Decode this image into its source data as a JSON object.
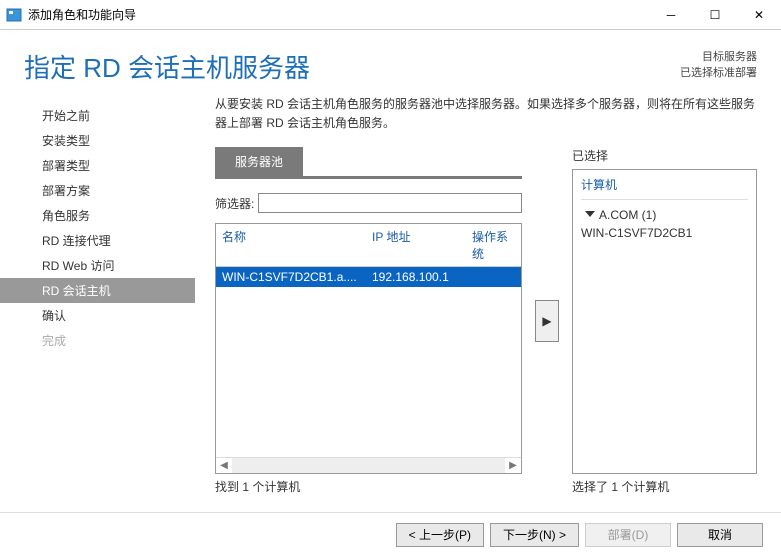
{
  "window": {
    "title": "添加角色和功能向导"
  },
  "header": {
    "page_title": "指定 RD 会话主机服务器",
    "right_line1": "目标服务器",
    "right_line2": "已选择标准部署"
  },
  "sidebar": {
    "items": [
      {
        "label": "开始之前"
      },
      {
        "label": "安装类型"
      },
      {
        "label": "部署类型"
      },
      {
        "label": "部署方案"
      },
      {
        "label": "角色服务"
      },
      {
        "label": "RD 连接代理"
      },
      {
        "label": "RD Web 访问"
      },
      {
        "label": "RD 会话主机",
        "selected": true
      },
      {
        "label": "确认"
      },
      {
        "label": "完成",
        "disabled": true
      }
    ]
  },
  "content": {
    "description": "从要安装 RD 会话主机角色服务的服务器池中选择服务器。如果选择多个服务器，则将在所有这些服务器上部署 RD 会话主机角色服务。",
    "tab_label": "服务器池",
    "filter_label": "筛选器:",
    "columns": {
      "name": "名称",
      "ip": "IP 地址",
      "os": "操作系统"
    },
    "rows": [
      {
        "name": "WIN-C1SVF7D2CB1.a....",
        "ip": "192.168.100.1",
        "os": ""
      }
    ],
    "status_left": "找到 1 个计算机",
    "selected_label": "已选择",
    "tree_header": "计算机",
    "tree_group": "A.COM (1)",
    "tree_child": "WIN-C1SVF7D2CB1",
    "status_right": "选择了 1 个计算机"
  },
  "footer": {
    "prev": "< 上一步(P)",
    "next": "下一步(N) >",
    "deploy": "部署(D)",
    "cancel": "取消"
  }
}
